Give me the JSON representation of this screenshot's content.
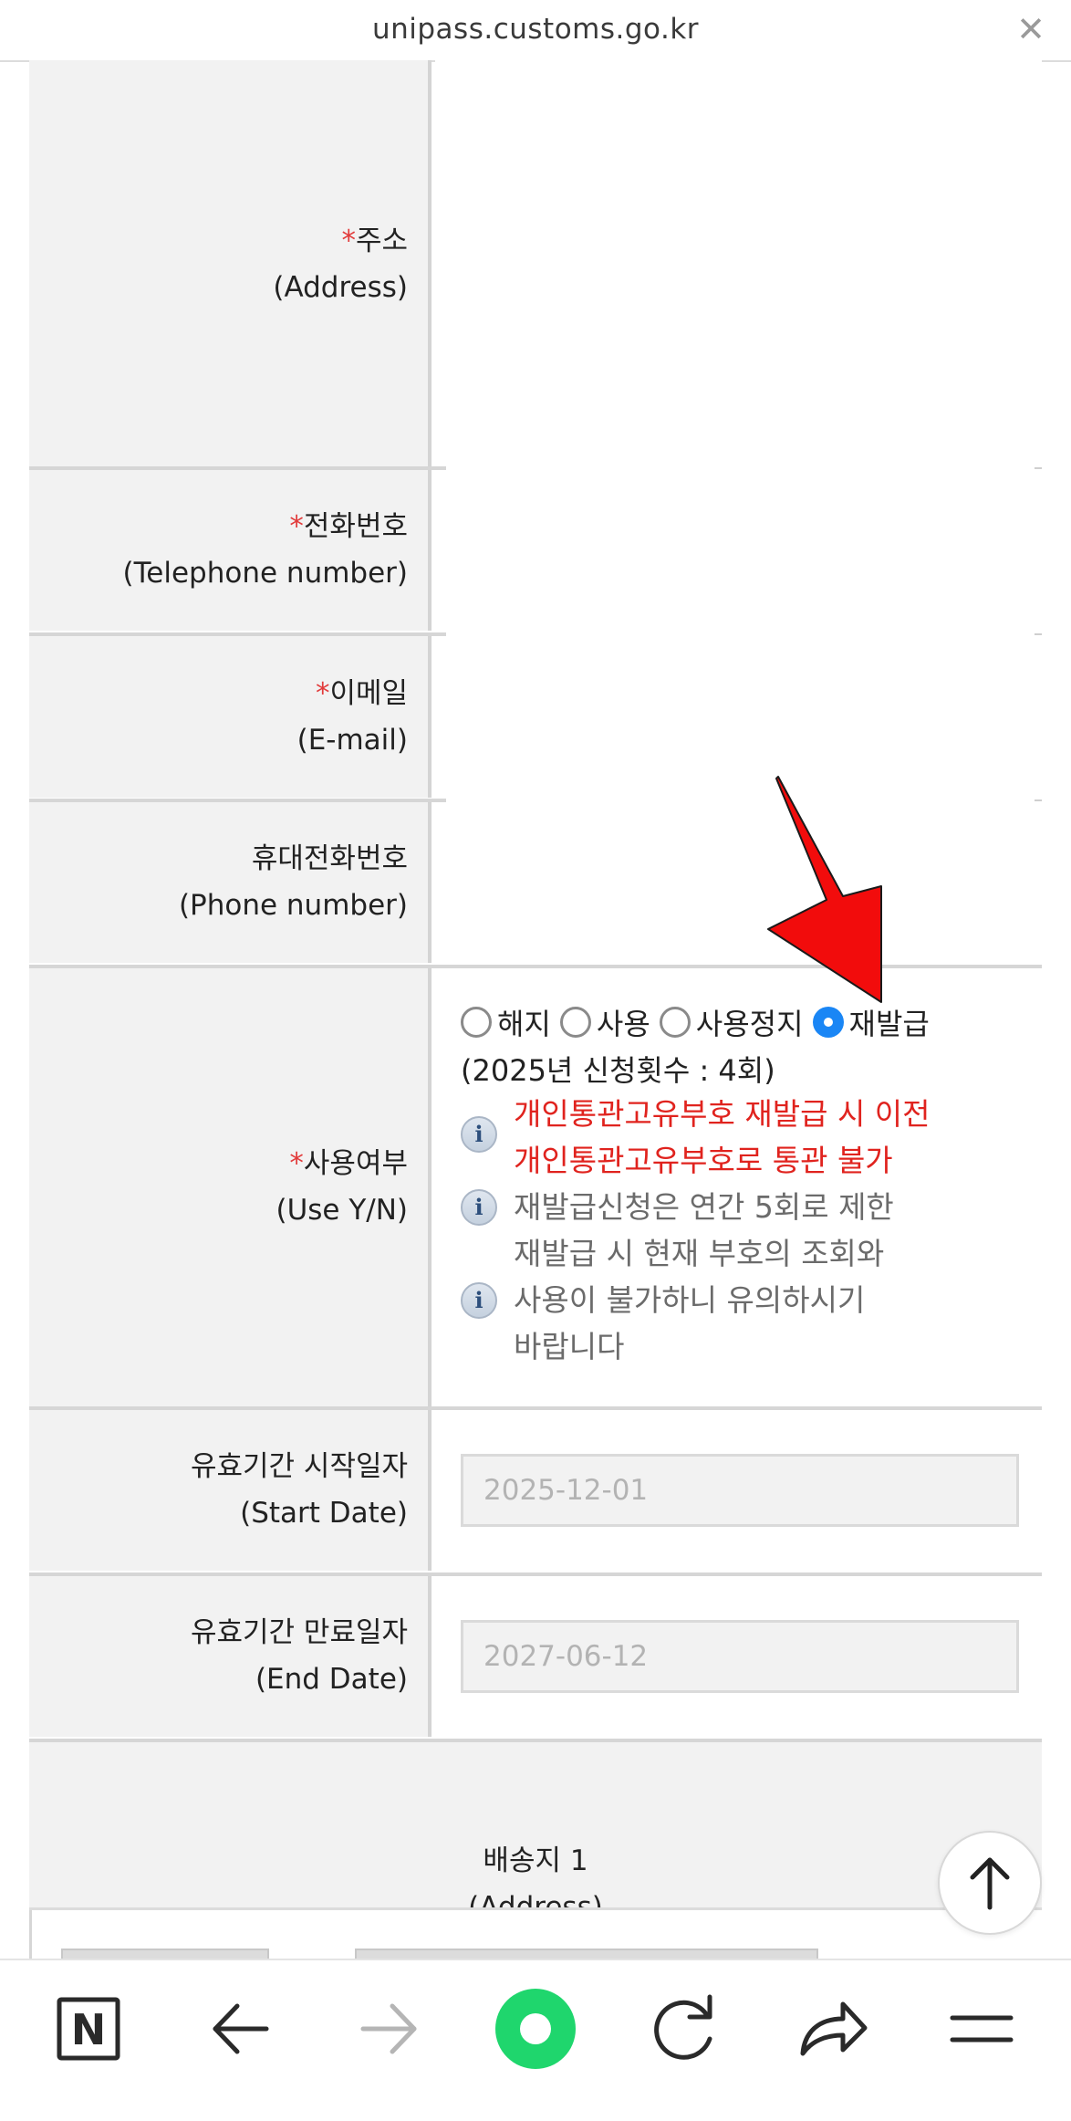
{
  "browser": {
    "url": "unipass.customs.go.kr",
    "close_icon": "close-icon"
  },
  "fields": {
    "address": {
      "required_mark": "*",
      "label_ko": "주소",
      "label_en": "(Address)"
    },
    "telephone": {
      "required_mark": "*",
      "label_ko": "전화번호",
      "label_en": "(Telephone number)"
    },
    "email": {
      "required_mark": "*",
      "label_ko": "이메일",
      "label_en": "(E-mail)"
    },
    "phone": {
      "label_ko": "휴대전화번호",
      "label_en": "(Phone number)"
    },
    "use_yn": {
      "required_mark": "*",
      "label_ko": "사용여부",
      "label_en": "(Use Y/N)",
      "options": [
        "해지",
        "사용",
        "사용정지",
        "재발급"
      ],
      "selected": "재발급",
      "count_text": "(2025년 신청횟수 : 4회)",
      "notes": [
        {
          "lines": [
            "개인통관고유부호 재발급 시 이전",
            "개인통관고유부호로 통관 불가"
          ],
          "color": "#e0231e"
        },
        {
          "lines": [
            "재발급신청은 연간 5회로 제한",
            "재발급 시 현재 부호의 조회와"
          ],
          "color": "#6b6b6b"
        },
        {
          "lines": [
            "사용이 불가하니 유의하시기",
            "바랍니다"
          ],
          "color": "#6b6b6b"
        }
      ],
      "info_icon_glyph": "i"
    },
    "start_date": {
      "label_ko": "유효기간 시작일자",
      "label_en": "(Start Date)",
      "value": "2025-12-01"
    },
    "end_date": {
      "label_ko": "유효기간 만료일자",
      "label_en": "(End Date)",
      "value": "2027-06-12"
    }
  },
  "delivery_section": {
    "title": "배송지 1",
    "subtitle": "(Address)"
  },
  "annotation_arrow_color": "#f20c0c",
  "nav": {
    "items": [
      "naver-home-icon",
      "back-arrow-icon",
      "forward-arrow-icon",
      "green-dot-icon",
      "reload-icon",
      "share-icon",
      "menu-icon"
    ],
    "accent": "#1fd66d",
    "naver_letter": "N"
  }
}
